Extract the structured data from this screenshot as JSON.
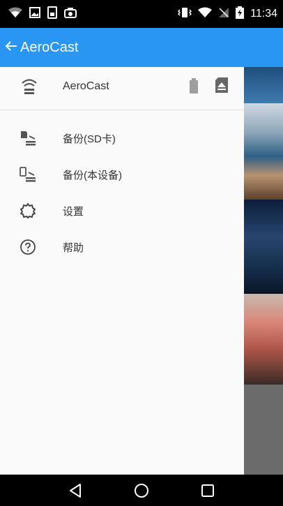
{
  "status_bar": {
    "time": "11:34",
    "left_icons": [
      "wifi-question-icon",
      "image-icon",
      "sim-icon",
      "camera-notify-icon"
    ],
    "right_icons": [
      "vibrate-icon",
      "wifi-icon",
      "no-signal-icon",
      "battery-charging-icon"
    ]
  },
  "app_bar": {
    "back_icon": "arrow-left-icon",
    "title": "AeroCast",
    "color": "#2a96f3"
  },
  "drawer": {
    "header": {
      "icon": "wifi-hotspot-icon",
      "title": "AeroCast",
      "battery_icon": "battery-icon",
      "sd_icon": "sd-card-eject-icon"
    },
    "items": [
      {
        "label": "备份(SD卡)",
        "icon": "sd-backup-icon"
      },
      {
        "label": "备份(本设备)",
        "icon": "device-backup-icon"
      },
      {
        "label": "设置",
        "icon": "gear-icon"
      },
      {
        "label": "帮助",
        "icon": "help-icon"
      }
    ]
  },
  "nav_bar": {
    "buttons": [
      "back-triangle-icon",
      "home-circle-icon",
      "recents-square-icon"
    ]
  }
}
